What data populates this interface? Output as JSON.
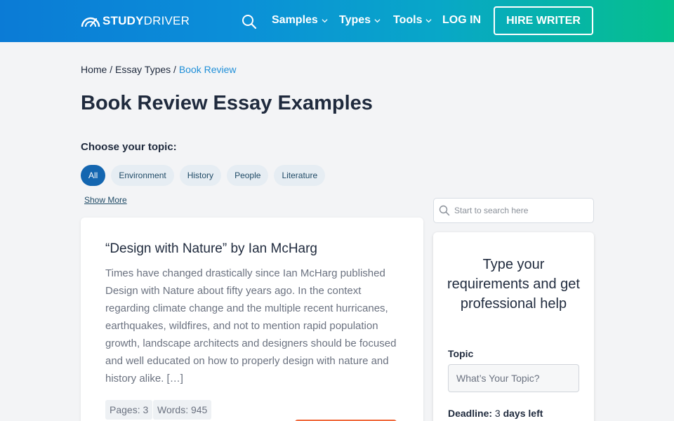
{
  "header": {
    "logo_bold": "STUDY",
    "logo_regular": "DRIVER",
    "nav": [
      {
        "label": "Samples"
      },
      {
        "label": "Types"
      },
      {
        "label": "Tools"
      }
    ],
    "login_label": "LOG IN",
    "hire_label": "HIRE WRITER"
  },
  "breadcrumb": {
    "home": "Home",
    "sep1": " / ",
    "essay_types": "Essay Types",
    "sep2": " / ",
    "current": "Book Review"
  },
  "page_title": "Book Review Essay Examples",
  "topics": {
    "label": "Choose your topic:",
    "chips": [
      "All",
      "Environment",
      "History",
      "People",
      "Literature"
    ],
    "show_more": "Show More"
  },
  "essay": {
    "title": "“Design with Nature” by Ian McHarg",
    "excerpt": "Times have changed drastically since Ian McHarg published Design with Nature about fifty years ago. In the context regarding climate change and the multiple recent hurricanes, earthquakes, wildfires, and not to mention rapid population growth, landscape architects and designers should be focused and well educated on how to properly design with nature and history alike. […]",
    "pages": "Pages: 3",
    "words": "Words: 945"
  },
  "sidebar": {
    "search_placeholder": "Start to search here",
    "help_title": "Type your requirements and get professional help",
    "topic_label": "Topic",
    "topic_placeholder": "What’s Your Topic?",
    "deadline_label": "Deadline:",
    "deadline_value": "3",
    "deadline_suffix": "days left"
  },
  "colors": {
    "header_gradient_start": "#0b7bd6",
    "header_gradient_end": "#05c08c",
    "accent_blue": "#1466b0",
    "link_blue": "#1f8fd8",
    "cta_orange": "#f06a3d"
  }
}
